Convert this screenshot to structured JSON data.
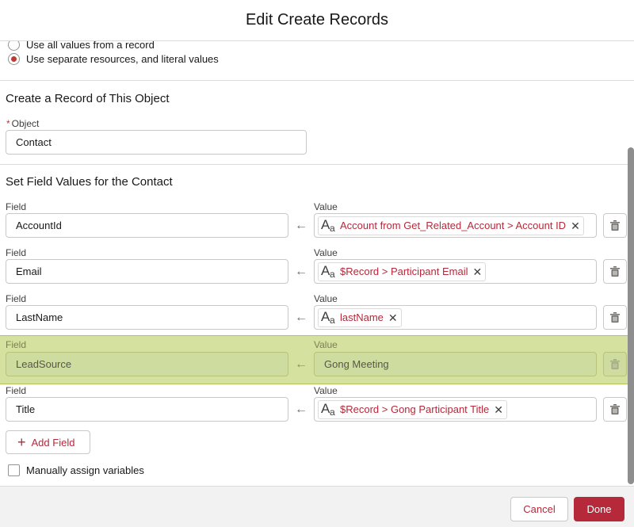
{
  "modal": {
    "title": "Edit Create Records"
  },
  "record_options": [
    {
      "label": "Use all values from a record",
      "checked": false
    },
    {
      "label": "Use separate resources, and literal values",
      "checked": true
    }
  ],
  "object_section": {
    "title": "Create a Record of This Object",
    "object_label": "Object",
    "required_mark": "*",
    "object_value": "Contact"
  },
  "fields_section": {
    "title": "Set Field Values for the Contact",
    "field_label": "Field",
    "value_label": "Value",
    "rows": [
      {
        "field": "AccountId",
        "value": "Account from Get_Related_Account > Account ID",
        "value_type": "resource"
      },
      {
        "field": "Email",
        "value": "$Record > Participant Email",
        "value_type": "resource"
      },
      {
        "field": "LastName",
        "value": "lastName",
        "value_type": "resource"
      },
      {
        "field": "LeadSource",
        "value": "Gong Meeting",
        "value_type": "literal",
        "highlighted": true
      },
      {
        "field": "Title",
        "value": "$Record > Gong Participant Title",
        "value_type": "resource"
      }
    ],
    "add_field_label": "Add Field",
    "manual_assign_label": "Manually assign variables"
  },
  "icons": {
    "text_type_big": "A",
    "text_type_small": "a",
    "remove": "✕",
    "arrow": "←",
    "plus": "+"
  },
  "footer": {
    "cancel_label": "Cancel",
    "done_label": "Done"
  },
  "colors": {
    "brand": "#b5293a",
    "highlight": "#c6d58d",
    "required": "#c23934"
  }
}
